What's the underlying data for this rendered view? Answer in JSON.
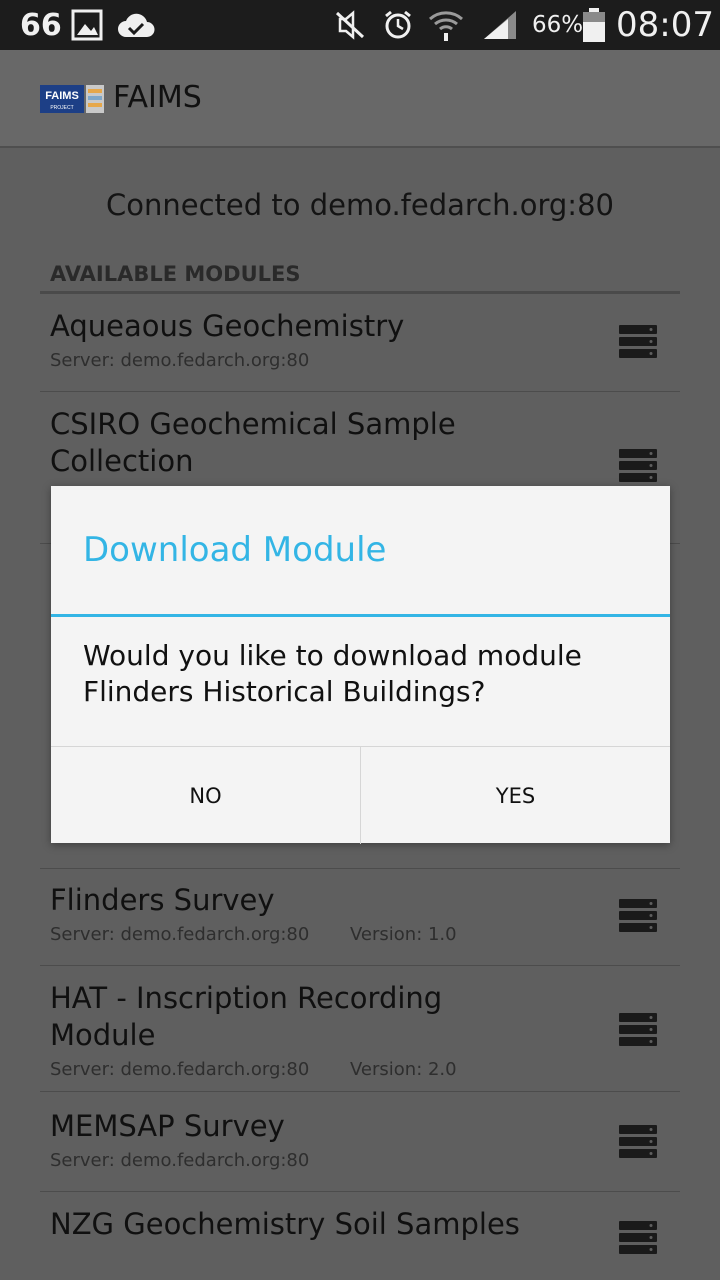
{
  "status_bar": {
    "notification_count": "66",
    "battery_percent": "66%",
    "time": "08:07",
    "icons": [
      "image-icon",
      "cloud-check-icon",
      "mute-icon",
      "alarm-icon",
      "wifi-icon",
      "signal-icon",
      "battery-icon"
    ]
  },
  "action_bar": {
    "logo_text": "FAIMS",
    "logo_subtext": "PROJECT",
    "title": "FAIMS"
  },
  "main": {
    "connected_text": "Connected to demo.fedarch.org:80",
    "section_header": "AVAILABLE MODULES",
    "modules": [
      {
        "name": "Aqueaous Geochemistry",
        "server": "Server: demo.fedarch.org:80",
        "version": ""
      },
      {
        "name": "CSIRO Geochemical Sample Collection",
        "server": "",
        "version": ""
      },
      {
        "name": "Flinders Survey",
        "server": "Server: demo.fedarch.org:80",
        "version": "Version: 1.0"
      },
      {
        "name": "HAT - Inscription Recording Module",
        "server": "Server: demo.fedarch.org:80",
        "version": "Version: 2.0"
      },
      {
        "name": "MEMSAP Survey",
        "server": "Server: demo.fedarch.org:80",
        "version": ""
      },
      {
        "name": "NZG Geochemistry Soil Samples",
        "server": "",
        "version": ""
      }
    ]
  },
  "dialog": {
    "title": "Download Module",
    "message": "Would you like to download module Flinders Historical Buildings?",
    "no_label": "NO",
    "yes_label": "YES"
  },
  "colors": {
    "accent": "#33b5e5",
    "dim_background": "#5f5f5f",
    "status_bar": "#1c1c1c",
    "dialog_background": "#f4f4f4"
  }
}
